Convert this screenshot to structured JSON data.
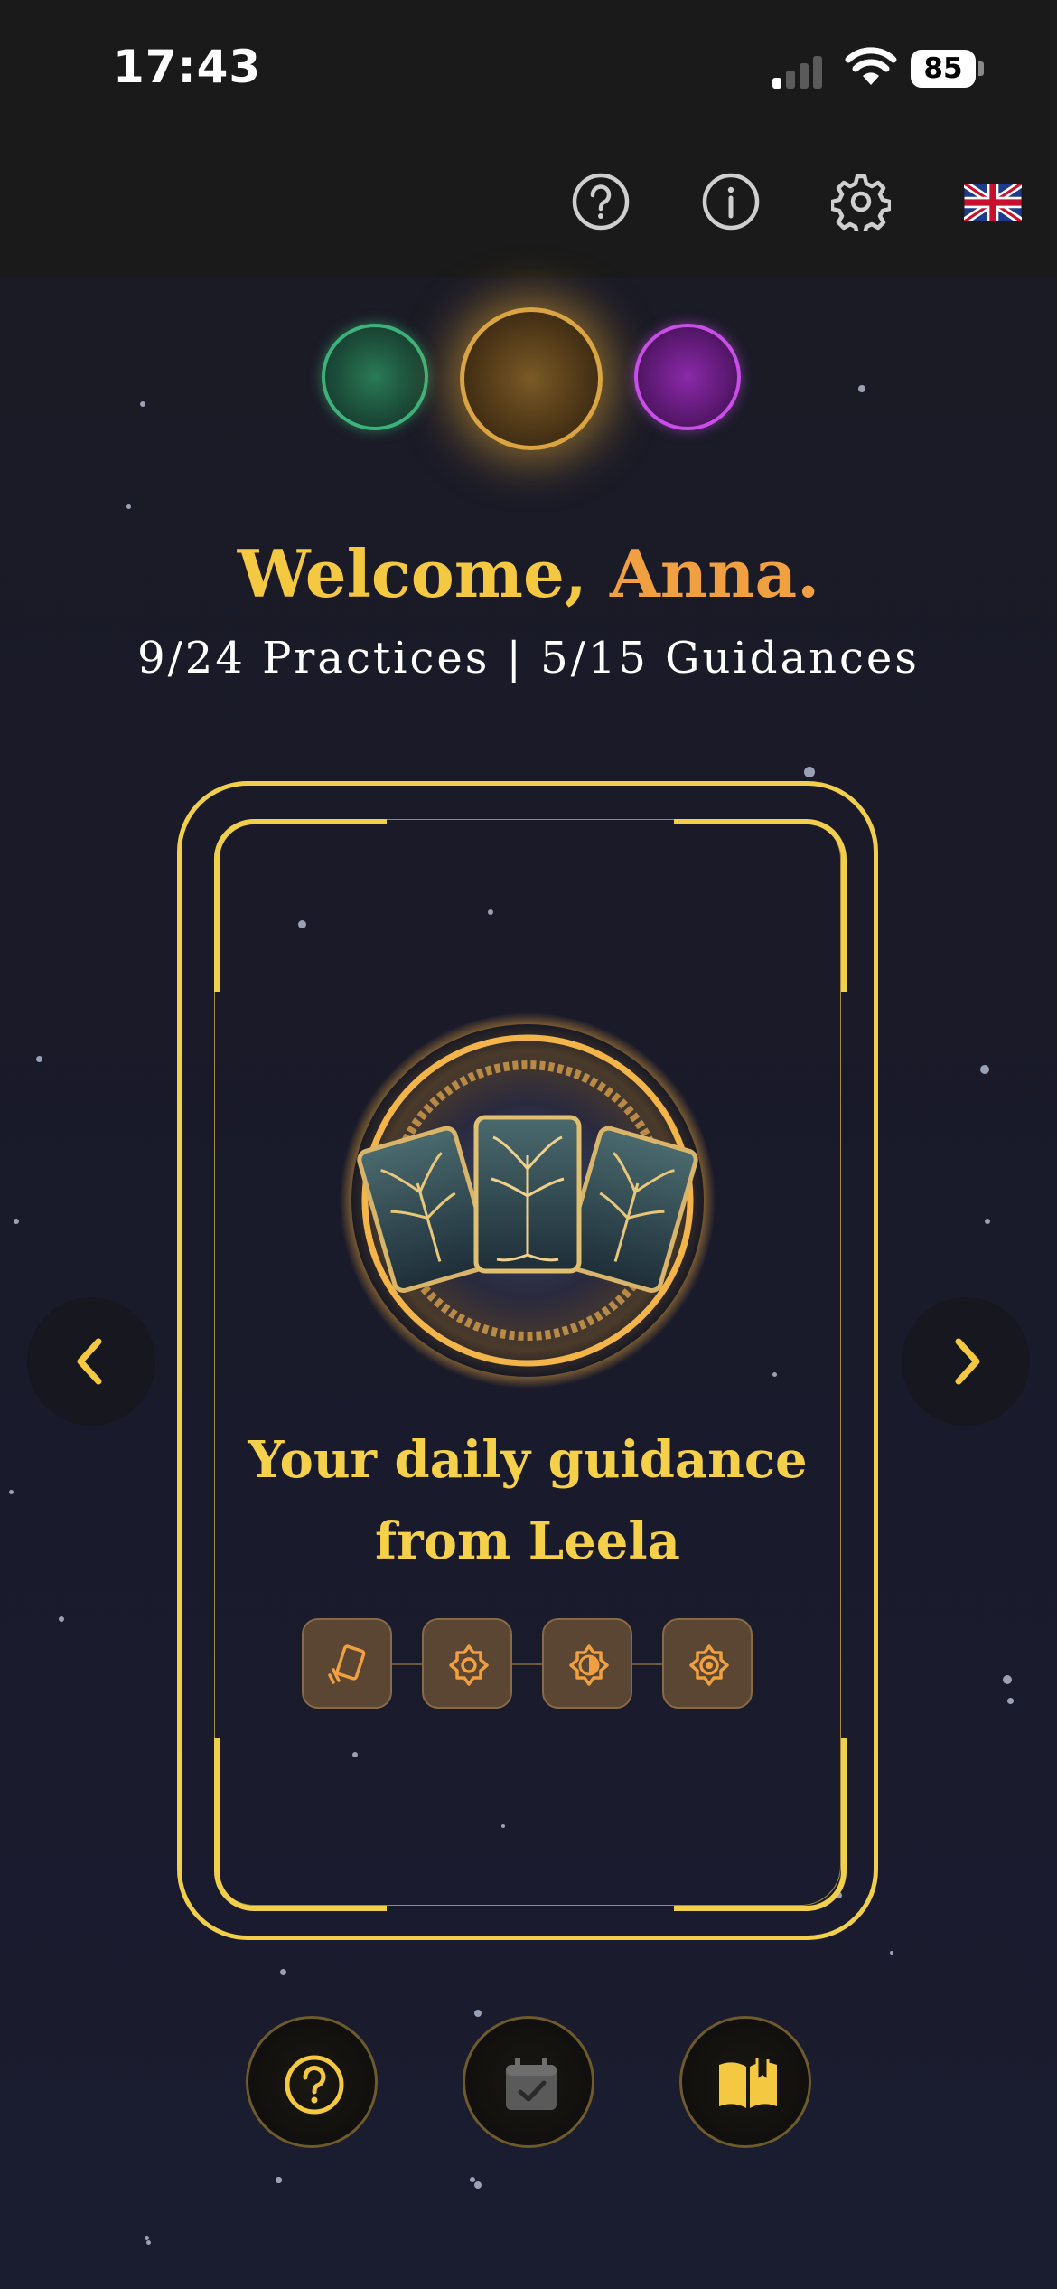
{
  "status_bar": {
    "time": "17:43",
    "battery": "85"
  },
  "welcome": {
    "greeting": "Welcome,",
    "name": "Anna."
  },
  "stats": {
    "text": "9/24 Practices | 5/15 Guidances"
  },
  "card": {
    "title_line1": "Your daily guidance",
    "title_line2": "from Leela"
  },
  "colors": {
    "gold": "#f5c842",
    "name_orange": "#f0a040",
    "background": "#16161f"
  }
}
